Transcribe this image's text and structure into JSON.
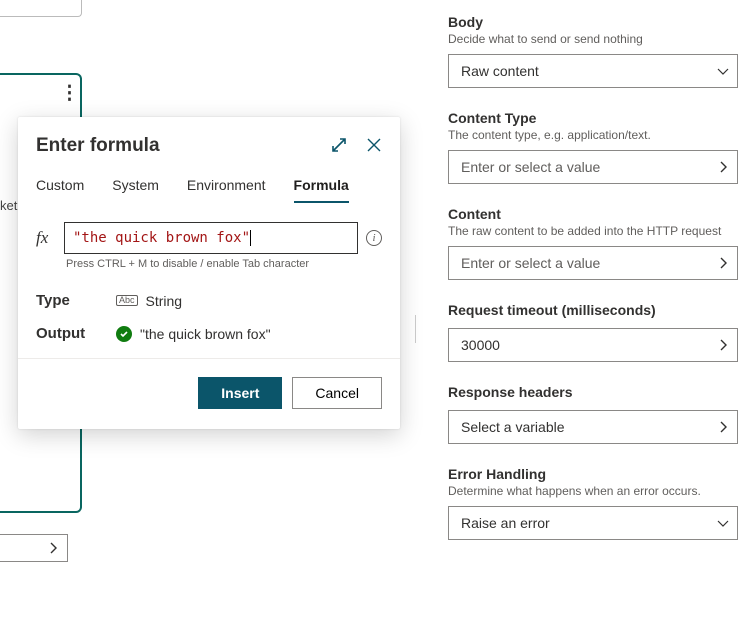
{
  "bg": {
    "ket": "ket"
  },
  "dialog": {
    "title": "Enter formula",
    "tabs": {
      "custom": "Custom",
      "system": "System",
      "environment": "Environment",
      "formula": "Formula"
    },
    "fx": "fx",
    "formula_value": "\"the quick brown fox\"",
    "hint": "Press CTRL + M to disable / enable Tab character",
    "type_label": "Type",
    "type_badge": "Abc",
    "type_value": "String",
    "output_label": "Output",
    "output_value": "\"the quick brown fox\"",
    "insert": "Insert",
    "cancel": "Cancel"
  },
  "panel": {
    "body": {
      "label": "Body",
      "desc": "Decide what to send or send nothing",
      "value": "Raw content"
    },
    "content_type": {
      "label": "Content Type",
      "desc": "The content type, e.g. application/text.",
      "placeholder": "Enter or select a value"
    },
    "content": {
      "label": "Content",
      "desc": "The raw content to be added into the HTTP request",
      "placeholder": "Enter or select a value"
    },
    "timeout": {
      "label": "Request timeout (milliseconds)",
      "value": "30000"
    },
    "response_headers": {
      "label": "Response headers",
      "placeholder": "Select a variable"
    },
    "error_handling": {
      "label": "Error Handling",
      "desc": "Determine what happens when an error occurs.",
      "value": "Raise an error"
    }
  }
}
